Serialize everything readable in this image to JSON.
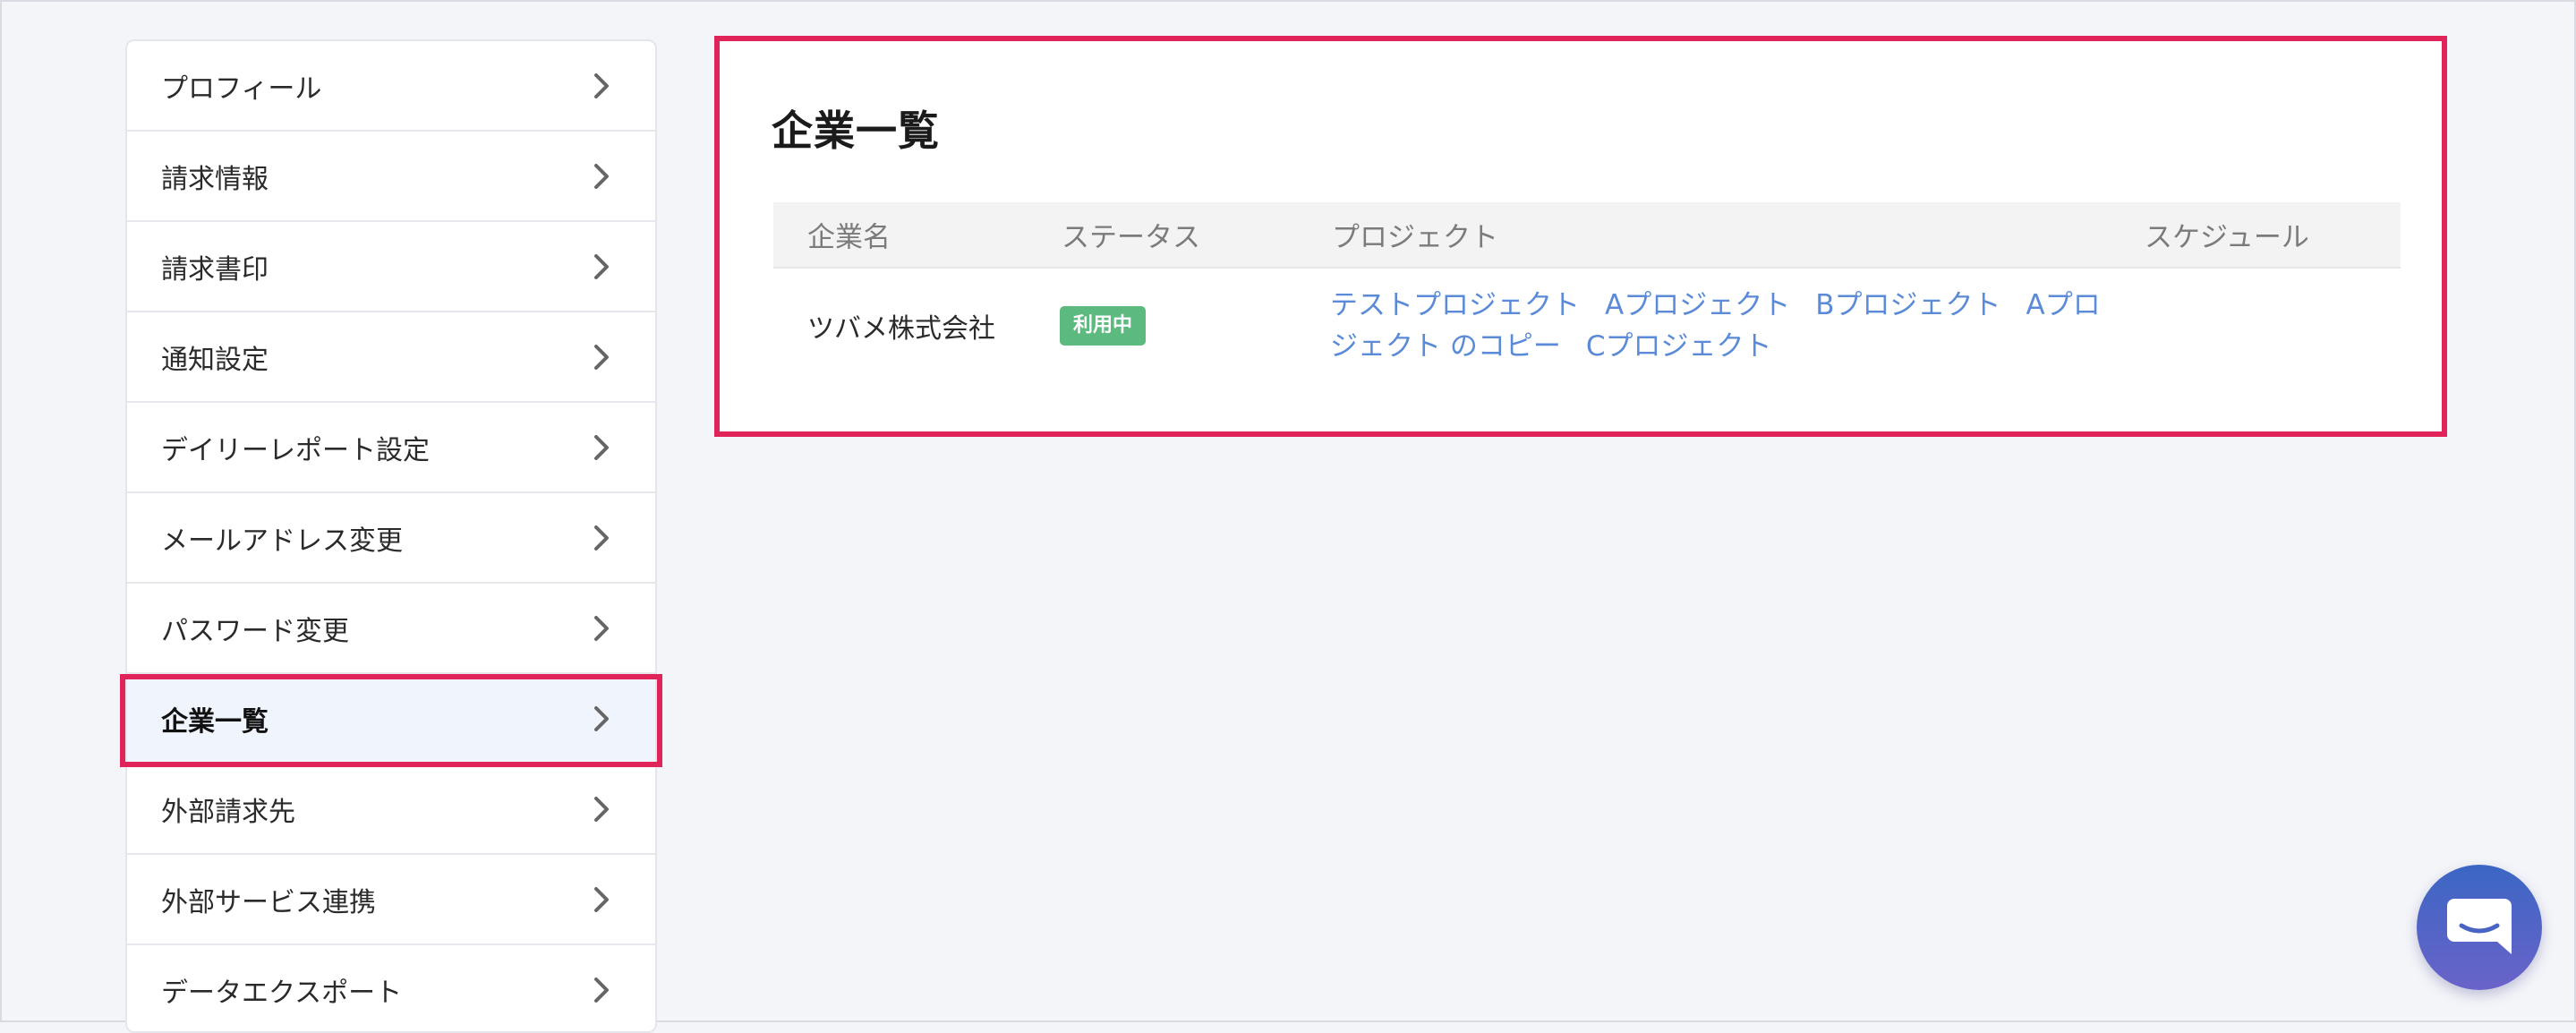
{
  "sidebar": {
    "items": [
      {
        "label": "プロフィール",
        "active": false
      },
      {
        "label": "請求情報",
        "active": false
      },
      {
        "label": "請求書印",
        "active": false
      },
      {
        "label": "通知設定",
        "active": false
      },
      {
        "label": "デイリーレポート設定",
        "active": false
      },
      {
        "label": "メールアドレス変更",
        "active": false
      },
      {
        "label": "パスワード変更",
        "active": false
      },
      {
        "label": "企業一覧",
        "active": true
      },
      {
        "label": "外部請求先",
        "active": false
      },
      {
        "label": "外部サービス連携",
        "active": false
      },
      {
        "label": "データエクスポート",
        "active": false
      }
    ]
  },
  "main": {
    "title": "企業一覧",
    "table": {
      "headers": [
        "企業名",
        "ステータス",
        "プロジェクト",
        "スケジュール"
      ],
      "rows": [
        {
          "company": "ツバメ株式会社",
          "status": "利用中",
          "projects": [
            "テストプロジェクト",
            "Aプロジェクト",
            "Bプロジェクト",
            "Aプロジェクト のコピー",
            "Cプロジェクト"
          ],
          "schedule": ""
        }
      ]
    }
  },
  "colors": {
    "highlight": "#e0245a",
    "link": "#5b8bd8",
    "status_badge": "#5cba7f",
    "chat_button": "#4a64c6"
  },
  "icons": {
    "sidebar_chevron": "chevron-right-icon",
    "chat": "chat-bubble-icon"
  }
}
